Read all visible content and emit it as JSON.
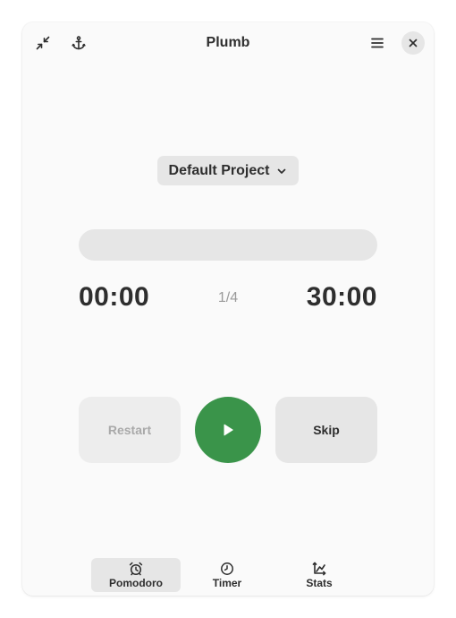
{
  "window": {
    "title": "Plumb"
  },
  "headerbar": {
    "left_icons": [
      "collapse-icon",
      "anchor-icon"
    ],
    "menu_icon": "hamburger-menu-icon",
    "close_icon": "close-icon"
  },
  "project": {
    "label": "Default Project",
    "icon": "chevron-down-icon"
  },
  "timer": {
    "progress_fraction": 0,
    "elapsed": "00:00",
    "remaining": "30:00",
    "session": "1/4"
  },
  "controls": {
    "restart_label": "Restart",
    "play_icon": "play-icon",
    "skip_label": "Skip"
  },
  "switcher": {
    "items": [
      {
        "label": "Pomodoro",
        "icon": "alarm-clock-icon",
        "active": true
      },
      {
        "label": "Timer",
        "icon": "clock-icon",
        "active": false
      },
      {
        "label": "Stats",
        "icon": "chart-axes-icon",
        "active": false
      }
    ]
  },
  "colors": {
    "accent": "#3a944a",
    "window_bg": "#fafafa",
    "button_bg": "#e6e6e6",
    "text": "#2e2e2e",
    "muted_text": "#9a9a9a"
  }
}
